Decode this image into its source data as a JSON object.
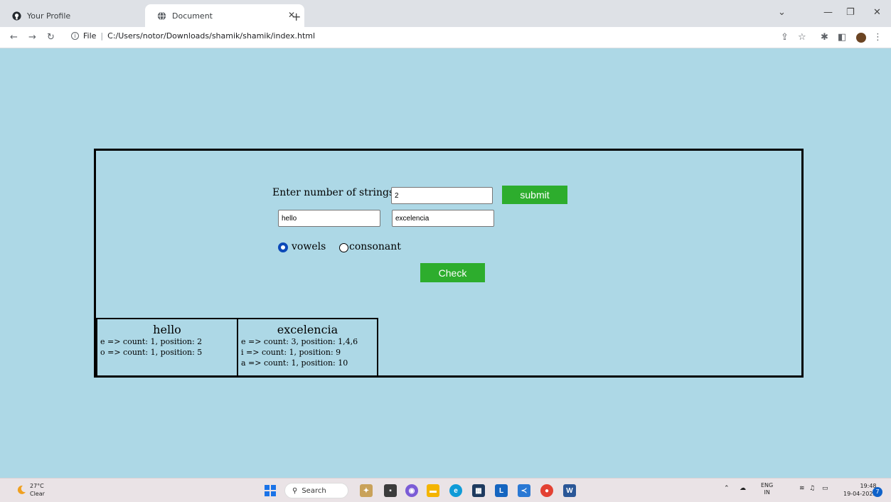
{
  "browser": {
    "tabs": [
      {
        "title": "Your Profile",
        "icon": "github-icon"
      },
      {
        "title": "Document",
        "icon": "globe-icon"
      }
    ],
    "address": {
      "scheme": "File",
      "path": "C:/Users/notor/Downloads/shamik/shamik/index.html"
    },
    "new_tab": "+"
  },
  "form": {
    "count_label": "Enter number of strings :",
    "count_value": "2",
    "submit_label": "submit",
    "string_inputs": [
      "hello",
      "excelencia"
    ],
    "radio_options": [
      {
        "label": "vowels",
        "selected": true
      },
      {
        "label": "consonant",
        "selected": false
      }
    ],
    "check_label": "Check",
    "button_color": "#2dad2d"
  },
  "results": [
    {
      "word": "hello",
      "lines": [
        "e => count: 1, position: 2",
        "o => count: 1, position: 5"
      ]
    },
    {
      "word": "excelencia",
      "lines": [
        "e => count: 3, position: 1,4,6",
        "i => count: 1, position: 9",
        "a => count: 1, position: 10"
      ]
    }
  ],
  "taskbar": {
    "weather_temp": "27°C",
    "weather_desc": "Clear",
    "search_label": "Search",
    "lang": "ENG",
    "region": "IN",
    "time": "19:48",
    "date": "19-04-2023",
    "notifications": "7"
  },
  "colors": {
    "page_bg": "#add8e6",
    "radio_selected": "#0b49b8"
  }
}
